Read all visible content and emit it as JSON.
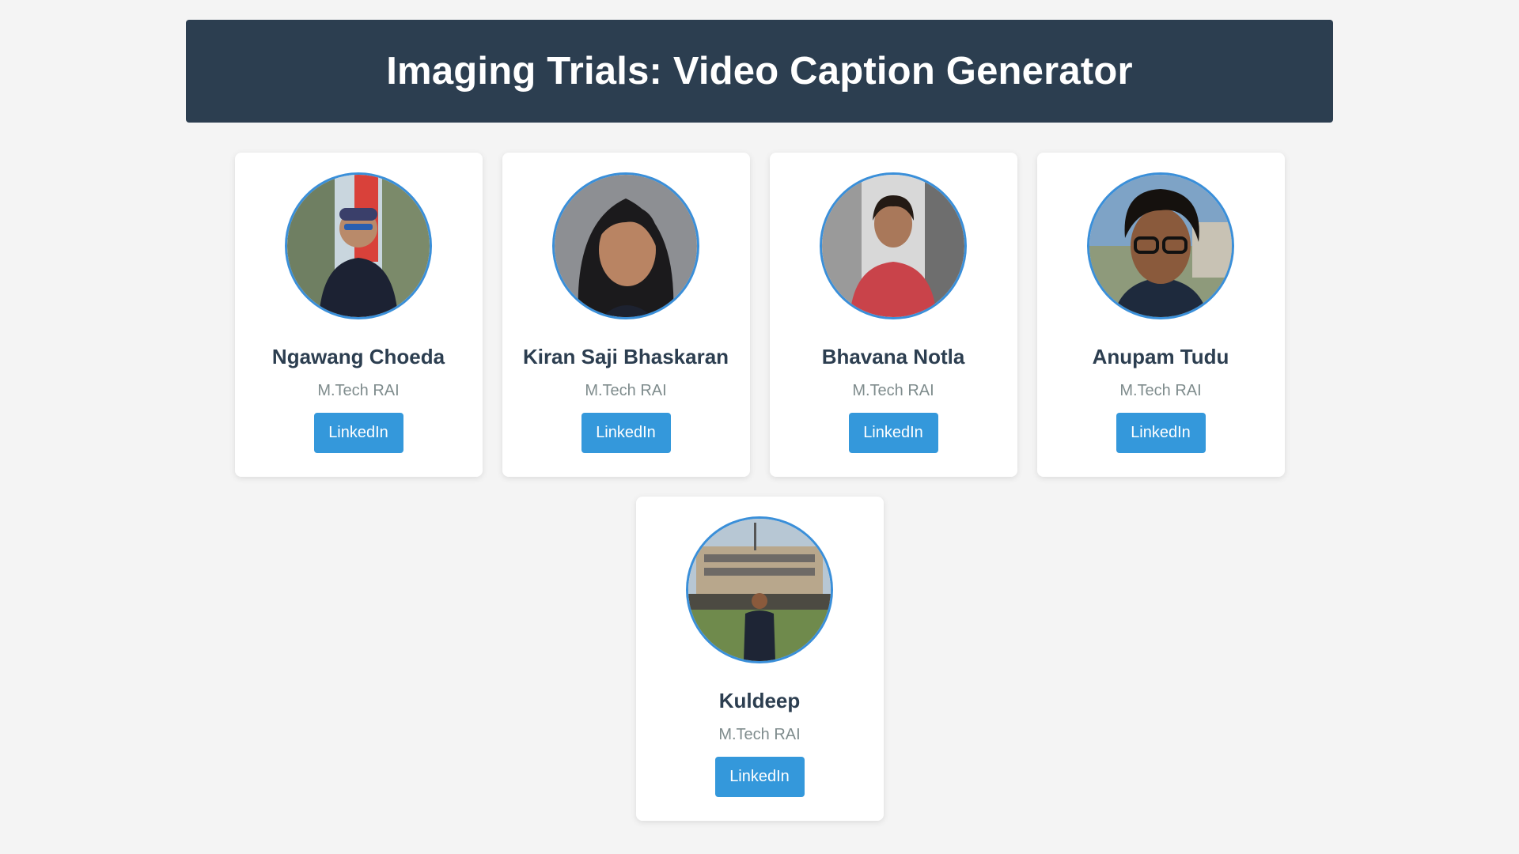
{
  "header": {
    "title": "Imaging Trials: Video Caption Generator"
  },
  "team": [
    {
      "name": "Ngawang Choeda",
      "role": "M.Tech RAI",
      "link_label": "LinkedIn",
      "photo": "person-portrait"
    },
    {
      "name": "Kiran Saji Bhaskaran",
      "role": "M.Tech RAI",
      "link_label": "LinkedIn",
      "photo": "person-portrait"
    },
    {
      "name": "Bhavana Notla",
      "role": "M.Tech RAI",
      "link_label": "LinkedIn",
      "photo": "person-portrait"
    },
    {
      "name": "Anupam Tudu",
      "role": "M.Tech RAI",
      "link_label": "LinkedIn",
      "photo": "person-portrait"
    },
    {
      "name": "Kuldeep",
      "role": "M.Tech RAI",
      "link_label": "LinkedIn",
      "photo": "person-portrait"
    }
  ],
  "colors": {
    "header_bg": "#2c3e50",
    "button_bg": "#3498db",
    "avatar_border": "#3a8fd9",
    "page_bg": "#f4f4f4"
  }
}
